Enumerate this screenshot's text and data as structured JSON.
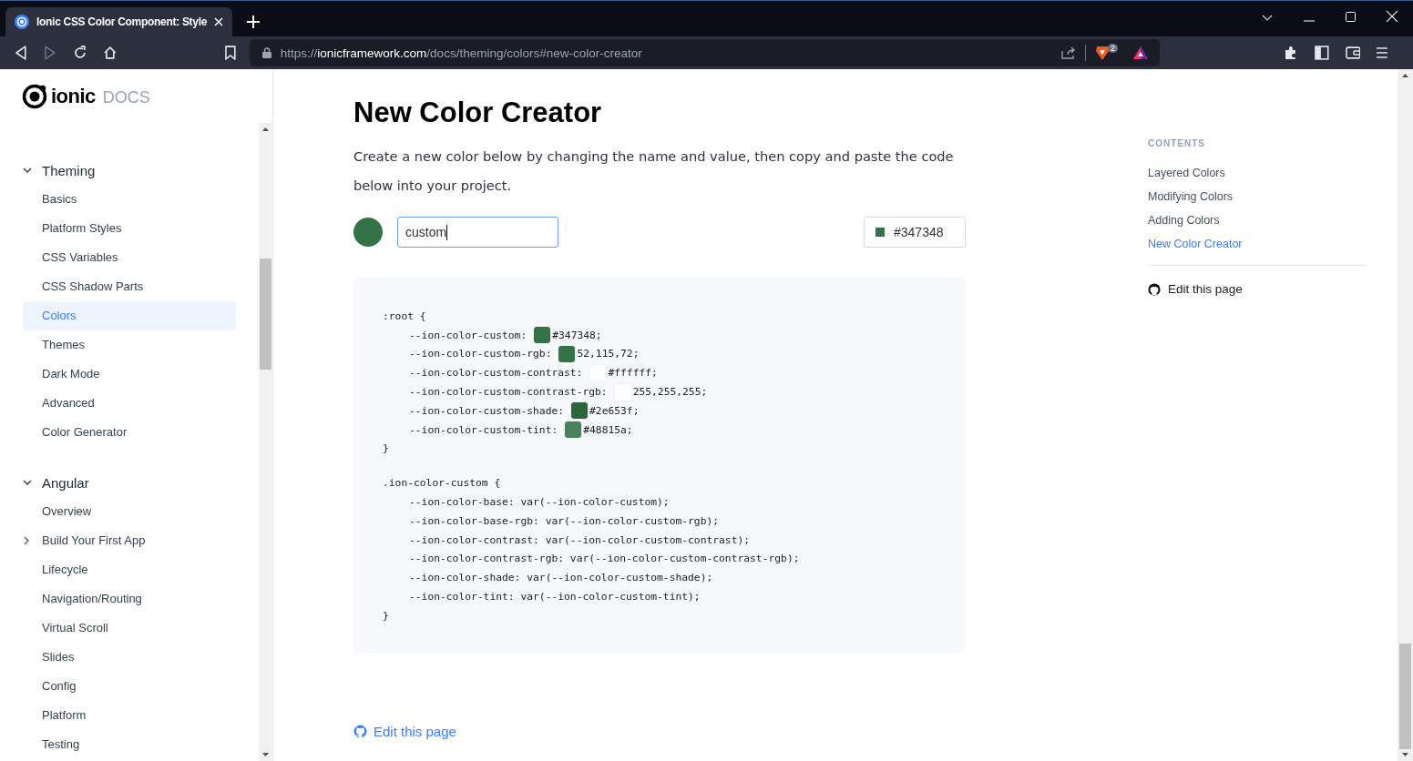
{
  "browser": {
    "tab": {
      "title": "Ionic CSS Color Component: Style",
      "selected": true
    },
    "url": "https://**ionicframework.com**/docs/theming/colors#new-color-creator",
    "shields_badge": "2",
    "forward_disabled": true
  },
  "logo": {
    "name": "ionic",
    "suffix": "DOCS"
  },
  "sidebar": {
    "groups": [
      {
        "label": "Theming",
        "expanded": true,
        "children": [
          {
            "label": "Basics",
            "selected": false
          },
          {
            "label": "Platform Styles",
            "selected": false
          },
          {
            "label": "CSS Variables",
            "selected": false
          },
          {
            "label": "CSS Shadow Parts",
            "selected": false
          },
          {
            "label": "Colors",
            "selected": true
          },
          {
            "label": "Themes",
            "selected": false
          },
          {
            "label": "Dark Mode",
            "selected": false
          },
          {
            "label": "Advanced",
            "selected": false
          },
          {
            "label": "Color Generator",
            "selected": false
          }
        ]
      },
      {
        "label": "Angular",
        "expanded": true,
        "children": [
          {
            "label": "Overview",
            "selected": false
          },
          {
            "label": "Build Your First App",
            "selected": false,
            "expanded": false
          },
          {
            "label": "Lifecycle",
            "selected": false
          },
          {
            "label": "Navigation/Routing",
            "selected": false
          },
          {
            "label": "Virtual Scroll",
            "selected": false
          },
          {
            "label": "Slides",
            "selected": false
          },
          {
            "label": "Config",
            "selected": false
          },
          {
            "label": "Platform",
            "selected": false
          },
          {
            "label": "Testing",
            "selected": false
          }
        ]
      }
    ]
  },
  "main": {
    "title": "New Color Creator",
    "intro": "Create a new color below by changing the name and value, then copy and paste the code below into your project.",
    "creator": {
      "color": "#347348",
      "name_value": "custom",
      "color_value": "#347348"
    },
    "code": {
      "root_open": ":root {",
      "root_lines": [
        {
          "name": "--ion-color-custom:",
          "color": "#347348",
          "value": "#347348;"
        },
        {
          "name": "--ion-color-custom-rgb:",
          "color": "#347348",
          "value": "52,115,72;"
        },
        {
          "name": "--ion-color-custom-contrast:",
          "color": "#ffffff",
          "value": "#ffffff;"
        },
        {
          "name": "--ion-color-custom-contrast-rgb:",
          "color": "#ffffff",
          "value": "255,255,255;"
        },
        {
          "name": "--ion-color-custom-shade:",
          "color": "#2e653f",
          "value": "#2e653f;"
        },
        {
          "name": "--ion-color-custom-tint:",
          "color": "#48815a",
          "value": "#48815a;"
        }
      ],
      "close_1": "}",
      "class_open": ".ion-color-custom {",
      "class_lines": [
        "--ion-color-base: var(--ion-color-custom);",
        "--ion-color-base-rgb: var(--ion-color-custom-rgb);",
        "--ion-color-contrast: var(--ion-color-custom-contrast);",
        "--ion-color-contrast-rgb: var(--ion-color-custom-contrast-rgb);",
        "--ion-color-shade: var(--ion-color-custom-shade);",
        "--ion-color-tint: var(--ion-color-custom-tint);"
      ],
      "close_2": "}"
    },
    "edit_link": "Edit this page"
  },
  "toc": {
    "heading": "CONTENTS",
    "items": [
      {
        "label": "Layered Colors",
        "selected": false
      },
      {
        "label": "Modifying Colors",
        "selected": false
      },
      {
        "label": "Adding Colors",
        "selected": false
      },
      {
        "label": "New Color Creator",
        "selected": true
      }
    ],
    "edit_link": "Edit this page"
  }
}
